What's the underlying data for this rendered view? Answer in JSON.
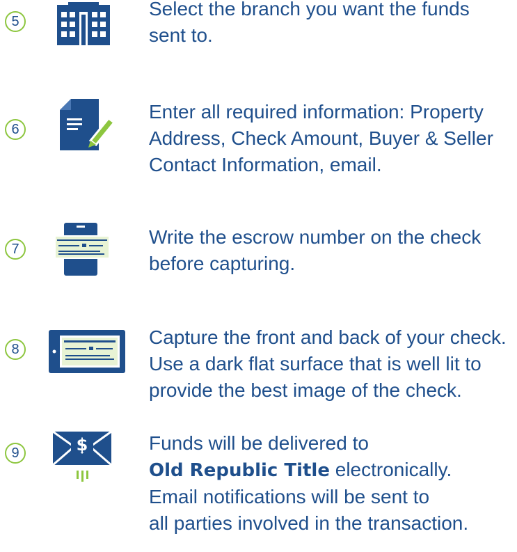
{
  "steps": [
    {
      "number": "5",
      "icon": "building-icon",
      "text": "Select the branch you want the funds\nsent to."
    },
    {
      "number": "6",
      "icon": "document-pen-icon",
      "text": "Enter all required information: Property\nAddress, Check Amount, Buyer & Seller\nContact Information, email."
    },
    {
      "number": "7",
      "icon": "phone-check-icon",
      "text": "Write the escrow number on the check\nbefore capturing."
    },
    {
      "number": "8",
      "icon": "tablet-check-icon",
      "text": "Capture the front and back of your check.\nUse a dark flat surface that is well lit to\nprovide the best image of the check."
    },
    {
      "number": "9",
      "icon": "envelope-dollar-icon",
      "text_line1": "Funds will be delivered to",
      "brand": "Old Republic Title",
      "text_after_brand": " electronically.\nEmail notifications will be sent to\nall parties involved in the transaction."
    }
  ],
  "colors": {
    "primary": "#1f4f8c",
    "accent": "#8dc63f",
    "check": "#e8f3d4"
  }
}
